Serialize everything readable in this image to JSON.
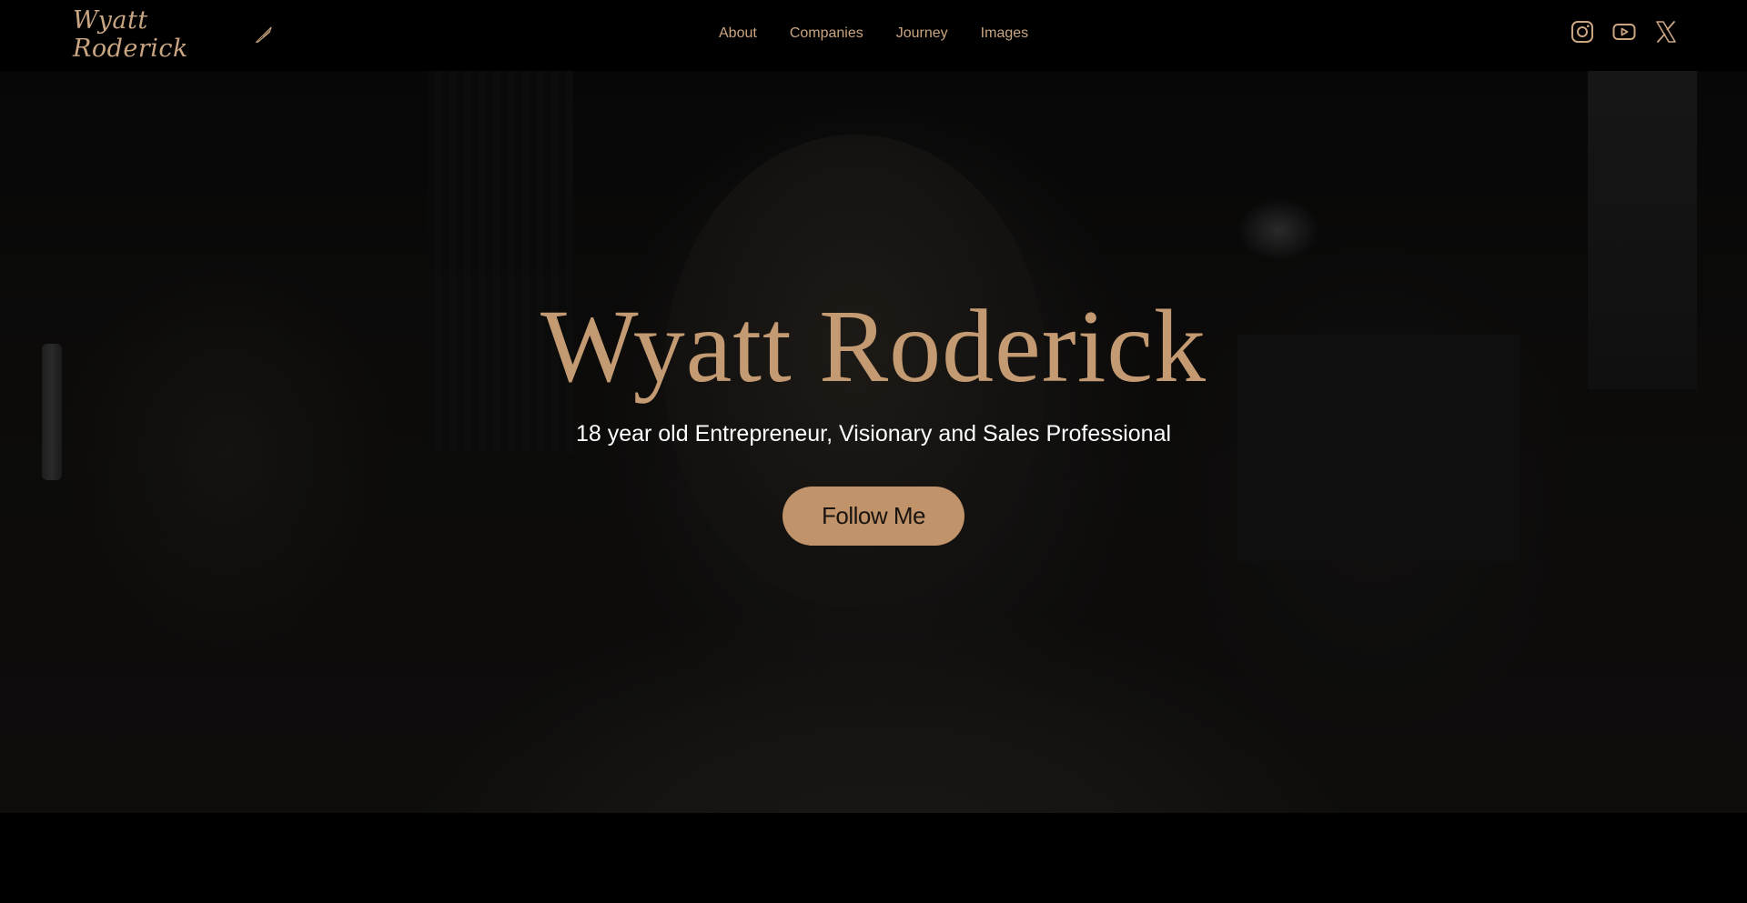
{
  "header": {
    "logo_text": "Wyatt Roderick",
    "nav": [
      {
        "label": "About"
      },
      {
        "label": "Companies"
      },
      {
        "label": "Journey"
      },
      {
        "label": "Images"
      }
    ],
    "socials": [
      {
        "icon": "instagram-icon"
      },
      {
        "icon": "youtube-icon"
      },
      {
        "icon": "x-twitter-icon"
      }
    ]
  },
  "hero": {
    "title": "Wyatt Roderick",
    "subtitle": "18 year old Entrepreneur, Visionary and Sales Professional",
    "cta_label": "Follow Me"
  },
  "colors": {
    "accent": "#c39a72",
    "button": "#c0936a",
    "background": "#000000",
    "subtitle": "#ffffff"
  }
}
